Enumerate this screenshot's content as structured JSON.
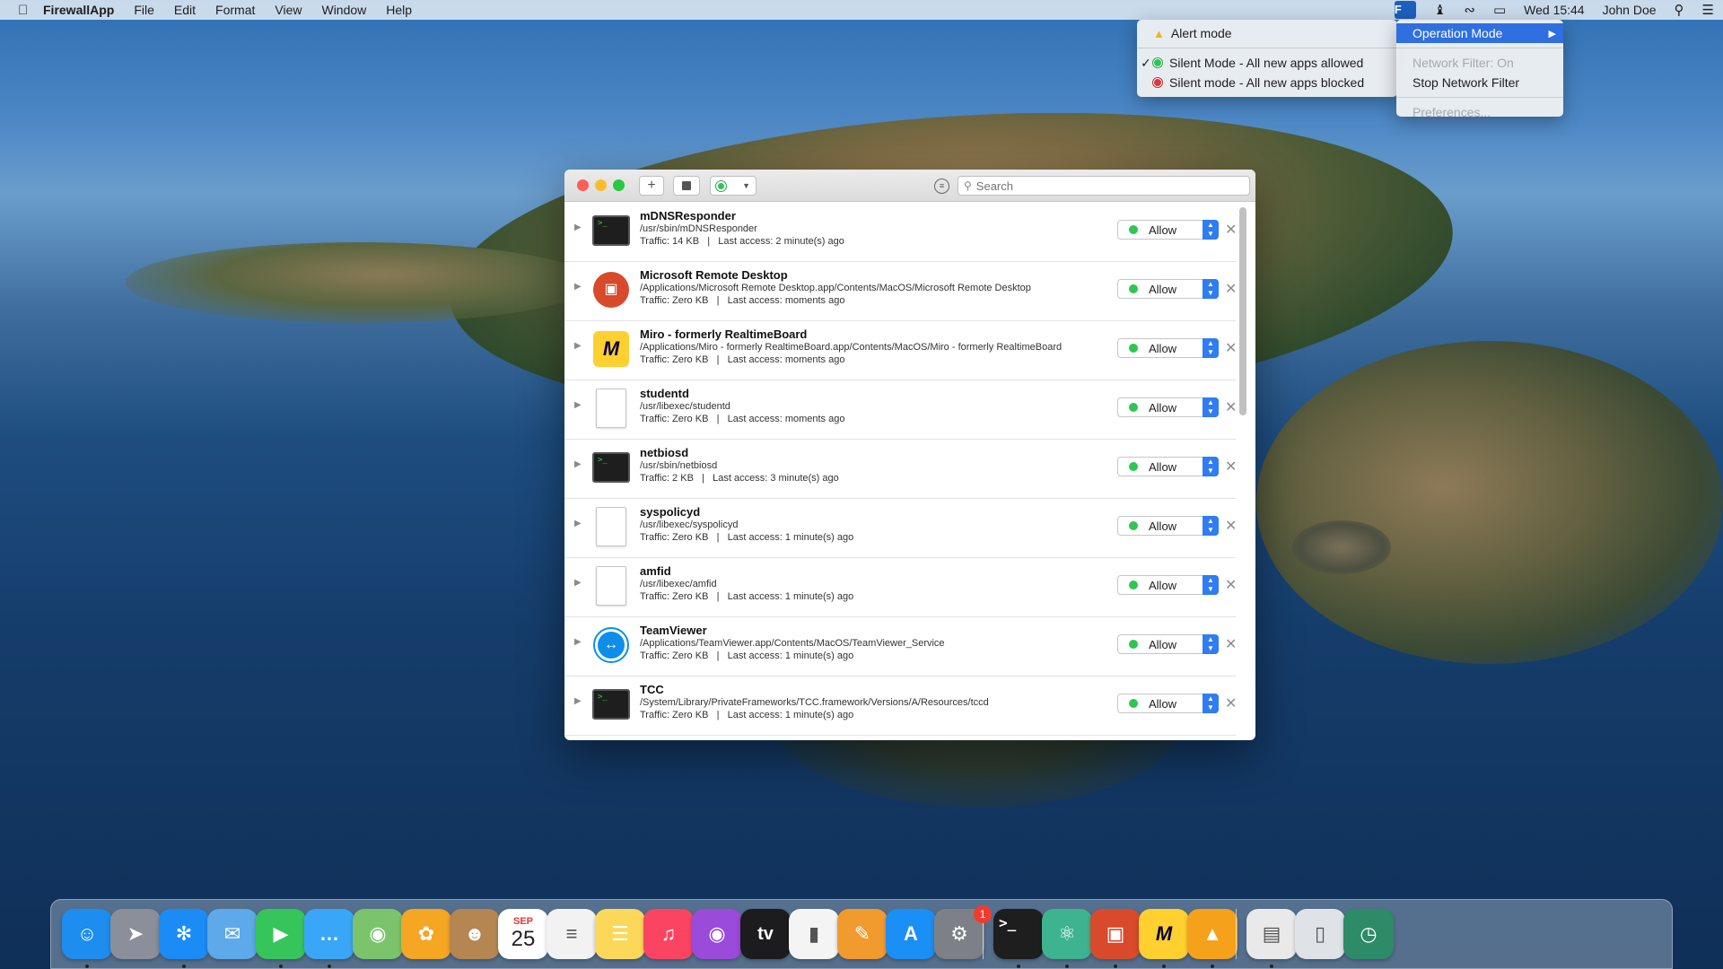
{
  "menubar": {
    "app_name": "FirewallApp",
    "menus": [
      "File",
      "Edit",
      "Format",
      "View",
      "Window",
      "Help"
    ],
    "clock": "Wed 15:44",
    "user": "John Doe"
  },
  "operation_submenu": {
    "items": [
      {
        "label": "Alert mode",
        "icon": "bell-icon",
        "checked": false
      },
      {
        "label": "Silent Mode - All new apps allowed",
        "icon": "green-dot",
        "checked": true
      },
      {
        "label": "Silent mode - All new apps blocked",
        "icon": "red-dot",
        "checked": false
      }
    ]
  },
  "status_menu": {
    "operation_mode": "Operation Mode",
    "network_filter_status": "Network Filter: On",
    "stop_filter": "Stop Network Filter",
    "preferences": "Preferences..."
  },
  "window": {
    "search_placeholder": "Search",
    "rows": [
      {
        "name": "mDNSResponder",
        "path": "/usr/sbin/mDNSResponder",
        "traffic": "Traffic: 14 KB",
        "last": "Last access: 2 minute(s) ago",
        "icon": "terminal-icon",
        "rule": "Allow"
      },
      {
        "name": "Microsoft Remote Desktop",
        "path": "/Applications/Microsoft Remote Desktop.app/Contents/MacOS/Microsoft Remote Desktop",
        "traffic": "Traffic: Zero KB",
        "last": "Last access: moments ago",
        "icon": "remote-desktop-icon",
        "rule": "Allow"
      },
      {
        "name": "Miro - formerly RealtimeBoard",
        "path": "/Applications/Miro - formerly RealtimeBoard.app/Contents/MacOS/Miro - formerly RealtimeBoard",
        "traffic": "Traffic: Zero KB",
        "last": "Last access: moments ago",
        "icon": "miro-icon",
        "rule": "Allow"
      },
      {
        "name": "studentd",
        "path": "/usr/libexec/studentd",
        "traffic": "Traffic: Zero KB",
        "last": "Last access: moments ago",
        "icon": "file-icon",
        "rule": "Allow"
      },
      {
        "name": "netbiosd",
        "path": "/usr/sbin/netbiosd",
        "traffic": "Traffic: 2 KB",
        "last": "Last access: 3 minute(s) ago",
        "icon": "terminal-icon",
        "rule": "Allow"
      },
      {
        "name": "syspolicyd",
        "path": "/usr/libexec/syspolicyd",
        "traffic": "Traffic: Zero KB",
        "last": "Last access: 1 minute(s) ago",
        "icon": "file-icon",
        "rule": "Allow"
      },
      {
        "name": "amfid",
        "path": "/usr/libexec/amfid",
        "traffic": "Traffic: Zero KB",
        "last": "Last access: 1 minute(s) ago",
        "icon": "file-icon",
        "rule": "Allow"
      },
      {
        "name": "TeamViewer",
        "path": "/Applications/TeamViewer.app/Contents/MacOS/TeamViewer_Service",
        "traffic": "Traffic: Zero KB",
        "last": "Last access: 1 minute(s) ago",
        "icon": "teamviewer-icon",
        "rule": "Allow"
      },
      {
        "name": "TCC",
        "path": "/System/Library/PrivateFrameworks/TCC.framework/Versions/A/Resources/tccd",
        "traffic": "Traffic: Zero KB",
        "last": "Last access: 1 minute(s) ago",
        "icon": "terminal-icon",
        "rule": "Allow"
      }
    ]
  },
  "dock": {
    "calendar_month": "SEP",
    "calendar_day": "25",
    "tv_label": "tv",
    "settings_badge": "1",
    "apps": [
      "finder",
      "launchpad",
      "safari",
      "mail",
      "facetime",
      "messages",
      "maps",
      "photos",
      "contacts",
      "calendar",
      "reminders",
      "notes",
      "music",
      "podcasts",
      "tv",
      "numbers",
      "pages",
      "app-store",
      "system-preferences",
      "terminal",
      "atom",
      "remote-desktop",
      "miro",
      "firewall",
      "archive",
      "trash",
      "time-machine"
    ],
    "colors": {
      "finder": "#1e8df0",
      "safari": "#1b8cf6",
      "facetime": "#36c55a",
      "messages": "#3aa6f7",
      "music": "#fb4461",
      "podcasts": "#9a4bd9",
      "appstore": "#1a8ff5",
      "miro": "#ffd02f"
    }
  }
}
